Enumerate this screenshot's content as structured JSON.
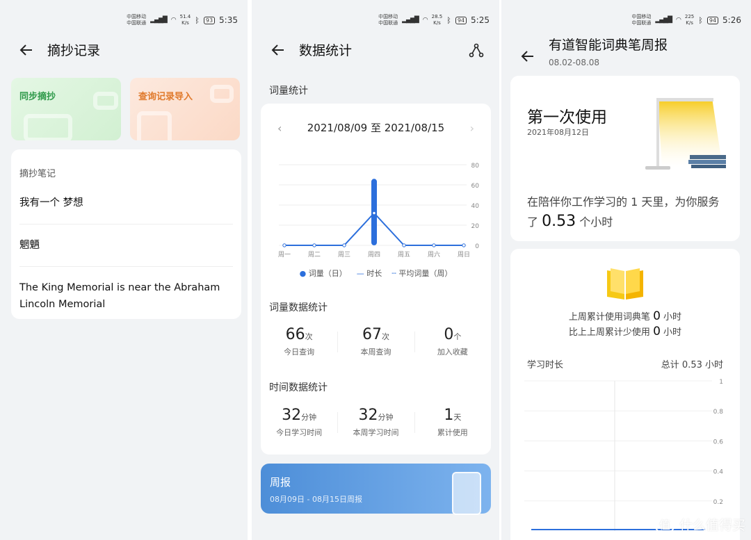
{
  "panel1": {
    "status": {
      "carrier1": "中国移动",
      "carrier2": "中国联通",
      "speed": "51.4",
      "speed_unit": "K/s",
      "battery": "93",
      "time": "5:35"
    },
    "title": "摘抄记录",
    "cards": {
      "sync": "同步摘抄",
      "import": "查询记录导入"
    },
    "notes_heading": "摘抄笔记",
    "notes": [
      "我有一个 梦想",
      "魍魉",
      "The King Memorial is near the Abraham Lincoln Memorial"
    ]
  },
  "panel2": {
    "status": {
      "carrier1": "中国移动",
      "carrier2": "中国联通",
      "speed": "28.5",
      "speed_unit": "K/s",
      "battery": "94",
      "time": "5:25"
    },
    "title": "数据统计",
    "section_vocab": "词量统计",
    "date_range": "2021/08/09 至 2021/08/15",
    "legend": {
      "daily": "词量（日）",
      "duration": "时长",
      "avg": "平均词量（周）"
    },
    "vocab_stats_title": "词量数据统计",
    "vocab_stats": [
      {
        "value": "66",
        "unit": "次",
        "label": "今日查询"
      },
      {
        "value": "67",
        "unit": "次",
        "label": "本周查询"
      },
      {
        "value": "0",
        "unit": "个",
        "label": "加入收藏"
      }
    ],
    "time_stats_title": "时间数据统计",
    "time_stats": [
      {
        "value": "32",
        "unit": "分钟",
        "label": "今日学习时间"
      },
      {
        "value": "32",
        "unit": "分钟",
        "label": "本周学习时间"
      },
      {
        "value": "1",
        "unit": "天",
        "label": "累计使用"
      }
    ],
    "weekly": {
      "title": "周报",
      "dates": "08月09日 - 08月15日周报"
    }
  },
  "panel3": {
    "status": {
      "carrier1": "中国移动",
      "carrier2": "中国联通",
      "speed": "225",
      "speed_unit": "K/s",
      "battery": "94",
      "time": "5:26"
    },
    "title": "有道智能词典笔周报",
    "subtitle": "08.02-08.08",
    "first_use": "第一次使用",
    "first_date": "2021年08月12日",
    "serve_pre": "在陪伴你工作学习的 1 天里，为你服务了",
    "serve_hours": "0.53",
    "serve_post": "个小时",
    "last_week_pre": "上周累计使用词典笔",
    "last_week_val": "0",
    "last_week_post": "小时",
    "compare_pre": "比上上周累计少使用",
    "compare_val": "0",
    "compare_post": "小时",
    "study_label": "学习时长",
    "study_total": "总计 0.53 小时",
    "watermark": "什么值得买"
  },
  "chart_data": [
    {
      "type": "line",
      "categories": [
        "周一",
        "周二",
        "周三",
        "周四",
        "周五",
        "周六",
        "周日"
      ],
      "series": [
        {
          "name": "词量（日）",
          "values": [
            0,
            0,
            0,
            66,
            0,
            0,
            0
          ]
        },
        {
          "name": "时长",
          "values": [
            0,
            0,
            0,
            32,
            0,
            0,
            0
          ]
        }
      ],
      "ylim": [
        0,
        80
      ],
      "yticks": [
        0,
        20,
        40,
        60,
        80
      ]
    },
    {
      "type": "line",
      "series": [
        {
          "values": [
            0,
            0,
            0,
            0,
            0,
            0,
            0
          ]
        }
      ],
      "ylim": [
        0,
        1
      ],
      "yticks": [
        0.2,
        0.4,
        0.6,
        0.8,
        1
      ]
    }
  ],
  "colors": {
    "blue": "#2c6fdc",
    "green": "#2f9a4a",
    "orange": "#e07a2c",
    "yellow": "#f6c915"
  }
}
